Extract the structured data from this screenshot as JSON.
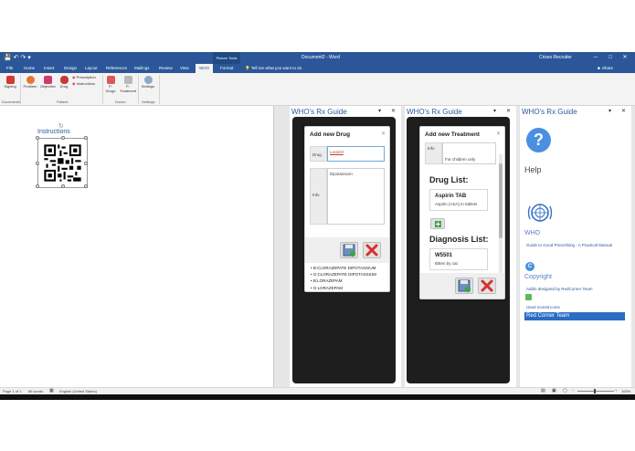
{
  "titlebar": {
    "quick_access": "💾 ↶ ↷ ▾",
    "contextual_tab": "Picture Tools",
    "document_title": "Document2 - Word",
    "user": "Crises Recruiter",
    "controls": [
      "─",
      "□",
      "✕"
    ]
  },
  "tabs": [
    "File",
    "Home",
    "Insert",
    "Design",
    "Layout",
    "References",
    "Mailings",
    "Review",
    "View",
    "WHO",
    "Format"
  ],
  "active_tab": "WHO",
  "tell_me": "💡 Tell me what you want to do",
  "share": "Share",
  "ribbon": {
    "documents": {
      "button": "Signing",
      "group": "Documents"
    },
    "patient": {
      "buttons": [
        "Problem",
        "Objective",
        "Drug"
      ],
      "small": [
        "Prescription",
        "Instructions"
      ],
      "group": "Patient"
    },
    "doctor": {
      "buttons": [
        "P-Drugs",
        "P-Treatment"
      ],
      "group": "Doctor"
    },
    "settings": {
      "button": "Settings",
      "group": "Settings"
    }
  },
  "document": {
    "caption": "Instructions"
  },
  "pane_title": "WHO's Rx Guide",
  "drug_card": {
    "title": "Add new Drug",
    "drug_label": "Drug",
    "drug_value": "Lorazel",
    "info_label": "Info",
    "info_value": "Dipotassium",
    "results": [
      "B:CLORAZEPATE DIPOTASSIUM",
      "G:CLORAZEPATE DIPOTASSIUM",
      "B:LORAZEPAM",
      "G:LORAZEPAM"
    ]
  },
  "treatment_card": {
    "title": "Add new Treatment",
    "info_label": "Info",
    "info_value": "For children only",
    "drug_list_header": "Drug List:",
    "drug_name": "Aspirin TAB",
    "drug_desc": "Aspirin (ASA) in tablets",
    "diagnosis_header": "Diagnosis List:",
    "diagnosis_code": "W5501",
    "diagnosis_desc": "Bitten by cat"
  },
  "help_pane": {
    "help_label": "Help",
    "who_label": "WHO",
    "who_link": "Guide to Good Prescribing - A Practical Manual",
    "copyright_label": "Copyright",
    "copyright_link": "Addin designed by RedCorner Team",
    "icons_link": "Used Icons8 icons",
    "team_label": "Red Corner Team"
  },
  "status": {
    "page": "Page 1 of 1",
    "words": "86 words",
    "language": "English (United States)",
    "zoom": "100%"
  },
  "colors": {
    "word_blue": "#2b579a",
    "delete_red": "#d9302b",
    "save_green": "#3fa34d",
    "team_bar": "#2b6cc4"
  }
}
